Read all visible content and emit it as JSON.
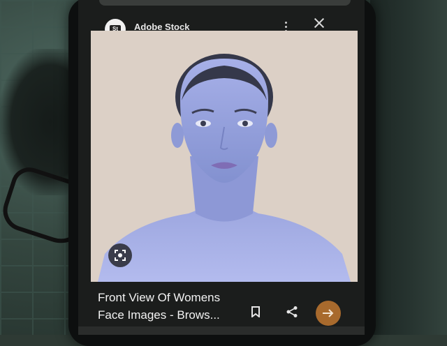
{
  "result_card": {
    "source_name": "Adobe Stock",
    "source_logo_text": "St",
    "title_line1": "Front View Of Womens",
    "title_line2": "Face Images - Brows..."
  },
  "icons": {
    "more": "more-vert-icon",
    "close": "close-icon",
    "lens": "lens-search-icon",
    "save": "bookmark-icon",
    "share": "share-icon",
    "visit": "arrow-right-icon"
  },
  "colors": {
    "visit_button": "#a86a2d",
    "image_background": "#dcd0c6",
    "portrait_tint": "#8e9ad6"
  }
}
